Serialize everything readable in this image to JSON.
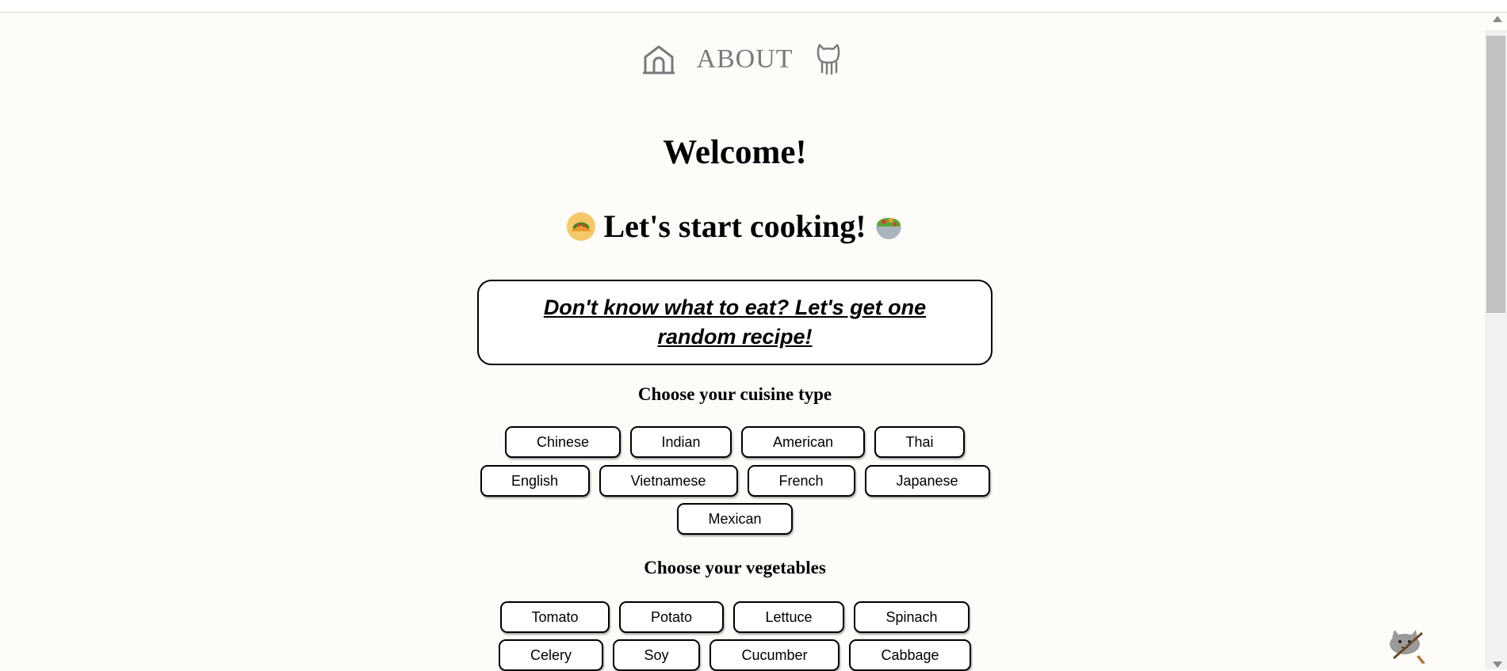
{
  "nav": {
    "home_icon": "home-icon",
    "about_label": "ABOUT",
    "github_icon": "octocat-icon"
  },
  "hero": {
    "welcome": "Welcome!",
    "cooking": "Let's start cooking!",
    "left_emoji": "taco-emoji",
    "right_emoji": "salad-emoji"
  },
  "random": {
    "label": "Don't know what to eat? Let's get one random recipe!"
  },
  "cuisine": {
    "title": "Choose your cuisine type",
    "rows": [
      [
        "Chinese",
        "Indian",
        "American",
        "Thai"
      ],
      [
        "English",
        "Vietnamese",
        "French",
        "Japanese"
      ],
      [
        "Mexican"
      ]
    ]
  },
  "vegetables": {
    "title": "Choose your vegetables",
    "rows": [
      [
        "Tomato",
        "Potato",
        "Lettuce",
        "Spinach"
      ],
      [
        "Celery",
        "Soy",
        "Cucumber",
        "Cabbage"
      ]
    ]
  },
  "mascot": {
    "icon": "cat-rowing-icon"
  }
}
